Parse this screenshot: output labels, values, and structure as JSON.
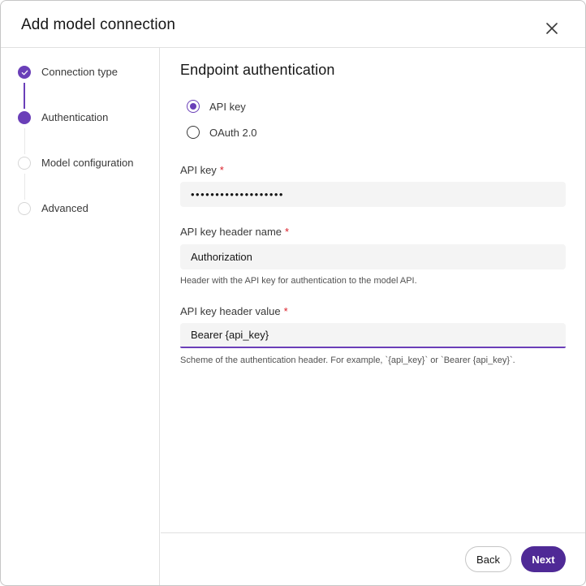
{
  "dialog": {
    "title": "Add model connection",
    "close_icon": "close-icon"
  },
  "steps": [
    {
      "label": "Connection type",
      "state": "completed"
    },
    {
      "label": "Authentication",
      "state": "current"
    },
    {
      "label": "Model configuration",
      "state": "upcoming"
    },
    {
      "label": "Advanced",
      "state": "upcoming"
    }
  ],
  "main": {
    "section_title": "Endpoint authentication",
    "auth_options": [
      {
        "label": "API key",
        "selected": true
      },
      {
        "label": "OAuth 2.0",
        "selected": false
      }
    ],
    "fields": {
      "api_key": {
        "label": "API key",
        "required_mark": "*",
        "value": "•••••••••••••••••••"
      },
      "header_name": {
        "label": "API key header name",
        "required_mark": "*",
        "value": "Authorization",
        "helper": "Header with the API key for authentication to the model API."
      },
      "header_value": {
        "label": "API key header value",
        "required_mark": "*",
        "value": "Bearer {api_key}",
        "helper": "Scheme of the authentication header. For example, `{api_key}` or `Bearer {api_key}`."
      }
    }
  },
  "footer": {
    "back_label": "Back",
    "next_label": "Next"
  },
  "colors": {
    "accent": "#6a3fb8",
    "primary_button": "#4f2a96",
    "required": "#da1e28"
  }
}
